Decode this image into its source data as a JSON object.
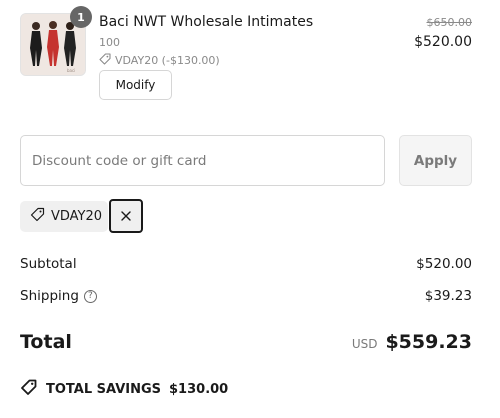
{
  "cart_item": {
    "quantity": "1",
    "name": "Baci NWT Wholesale Intimates",
    "variant": "100",
    "discount": "VDAY20 (-$130.00)",
    "original_price": "$650.00",
    "price": "$520.00",
    "modify_label": "Modify",
    "image_icon": "lingerie-product-photo"
  },
  "discount_form": {
    "placeholder": "Discount code or gift card",
    "value": "",
    "apply_label": "Apply"
  },
  "applied_code": {
    "code": "VDAY20",
    "tag_icon": "tag-icon",
    "remove_icon": "close-icon"
  },
  "summary": {
    "subtotal_label": "Subtotal",
    "subtotal_value": "$520.00",
    "shipping_label": "Shipping",
    "shipping_help_icon": "?",
    "shipping_value": "$39.23",
    "total_label": "Total",
    "currency": "USD",
    "total_value": "$559.23"
  },
  "savings": {
    "label": "TOTAL SAVINGS",
    "value": "$130.00"
  },
  "colors": {
    "text": "#1a1a1a",
    "muted": "#8a8a8a",
    "badge": "#666666",
    "chip_bg": "#f0f0f0",
    "border": "#d6d6d6"
  }
}
